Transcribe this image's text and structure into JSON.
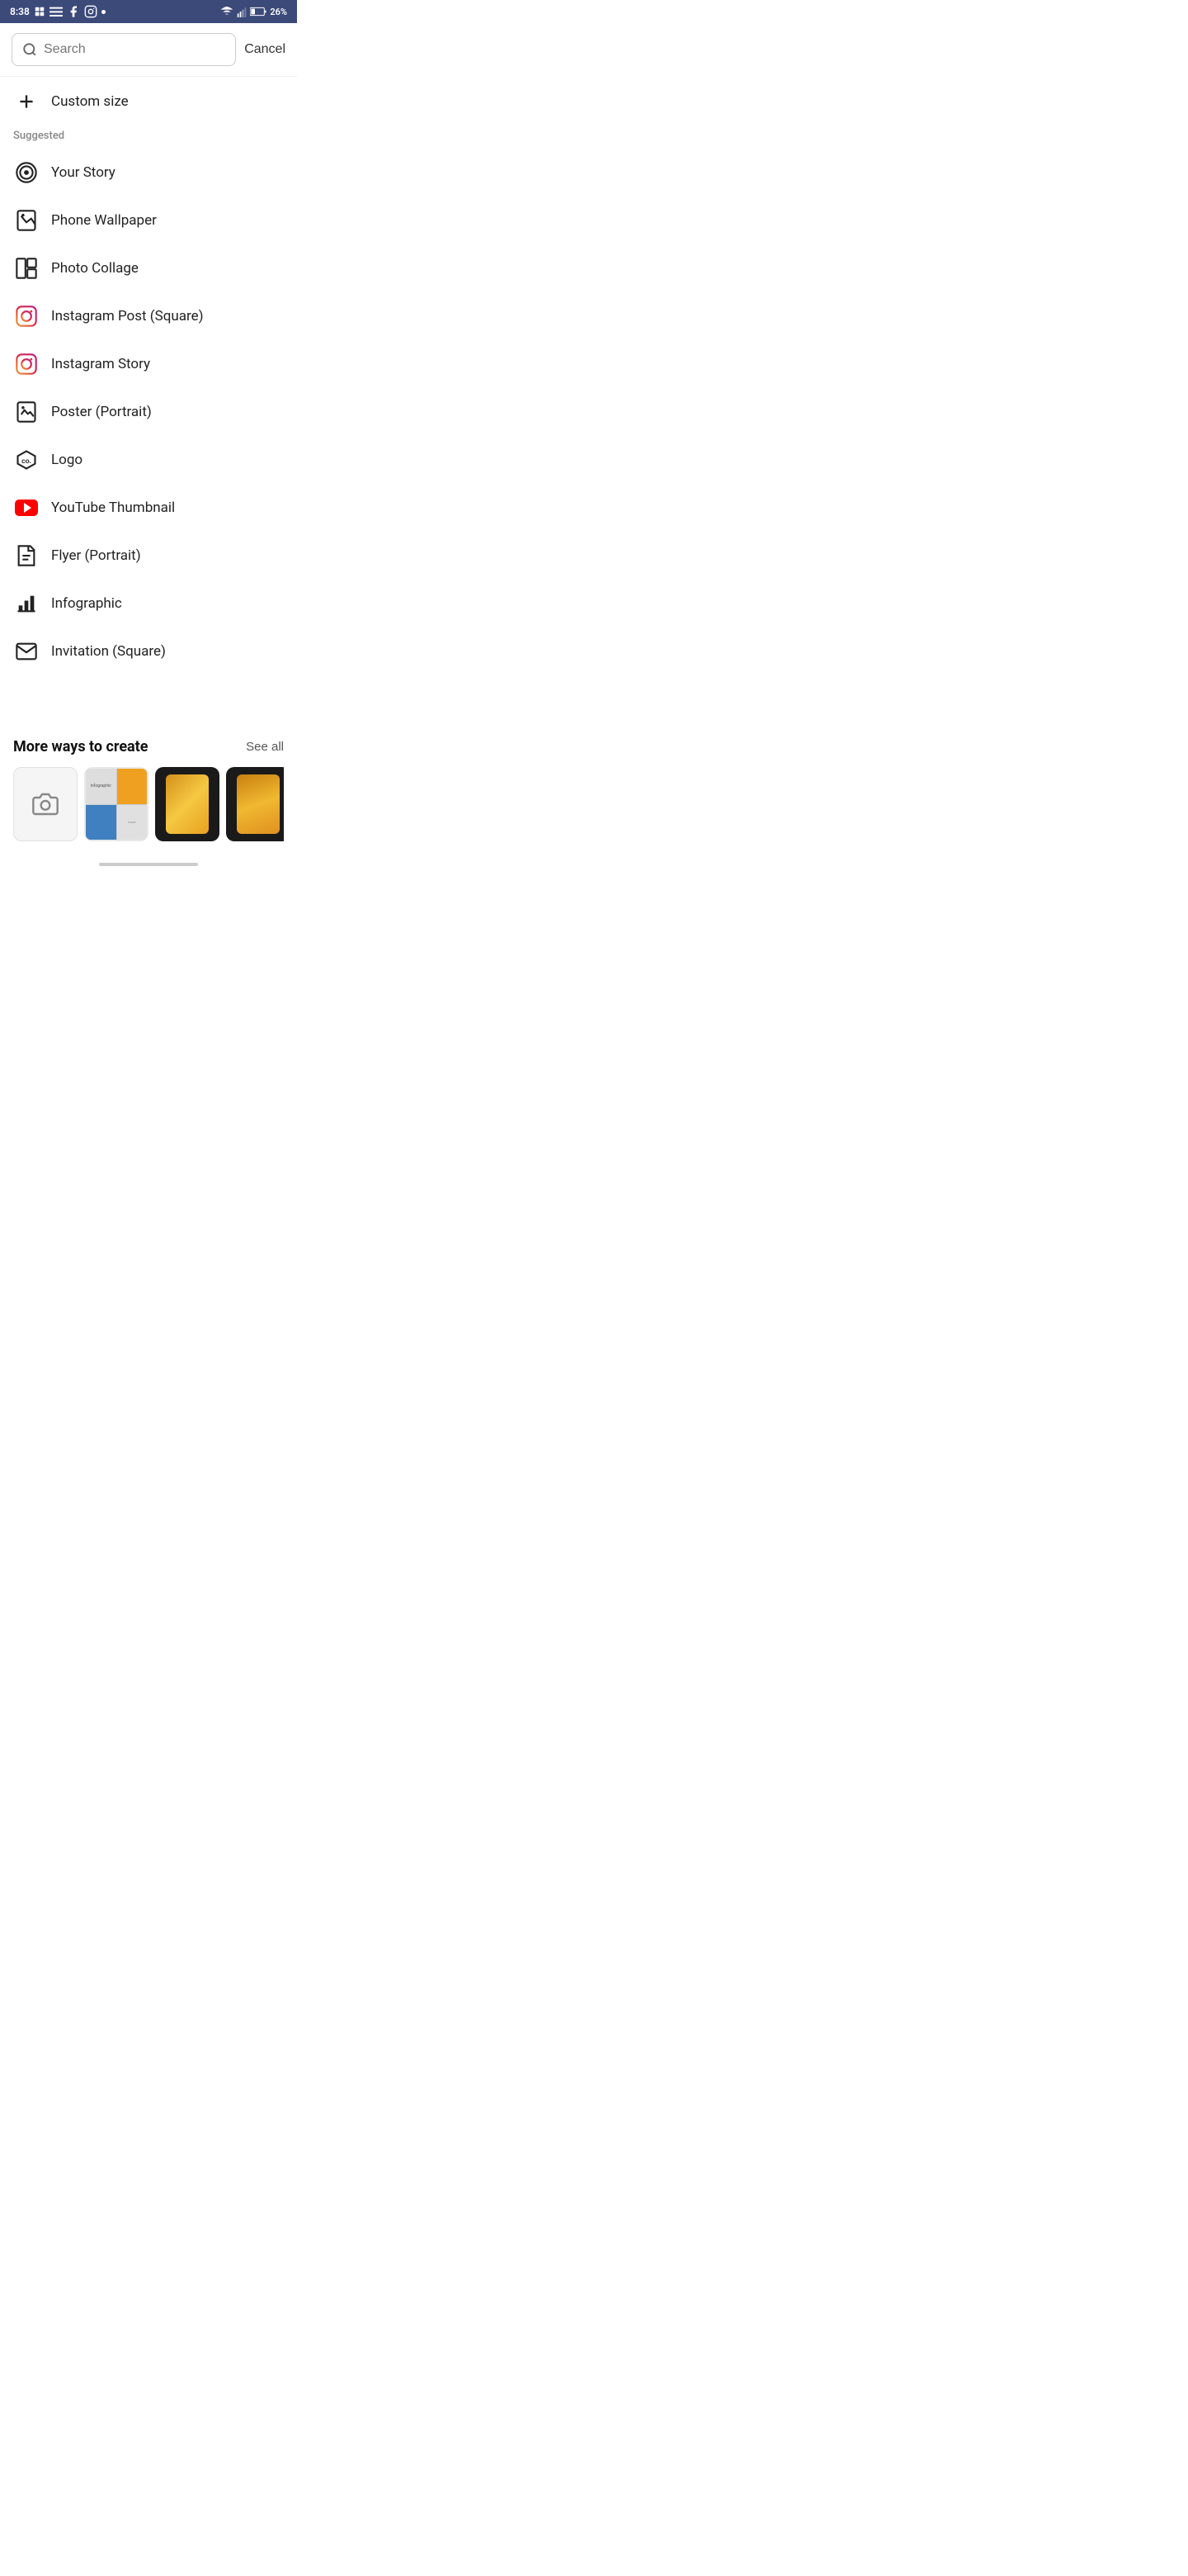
{
  "statusBar": {
    "time": "8:38",
    "battery": "26%"
  },
  "search": {
    "placeholder": "Search",
    "cancelLabel": "Cancel"
  },
  "customSize": {
    "label": "Custom size"
  },
  "suggested": {
    "sectionLabel": "Suggested",
    "items": [
      {
        "id": "your-story",
        "label": "Your Story",
        "icon": "camera-story"
      },
      {
        "id": "phone-wallpaper",
        "label": "Phone Wallpaper",
        "icon": "phone-wallpaper"
      },
      {
        "id": "photo-collage",
        "label": "Photo Collage",
        "icon": "photo-collage"
      },
      {
        "id": "instagram-post-square",
        "label": "Instagram Post (Square)",
        "icon": "instagram"
      },
      {
        "id": "instagram-story",
        "label": "Instagram Story",
        "icon": "instagram"
      },
      {
        "id": "poster-portrait",
        "label": "Poster (Portrait)",
        "icon": "poster"
      },
      {
        "id": "logo",
        "label": "Logo",
        "icon": "logo"
      },
      {
        "id": "youtube-thumbnail",
        "label": "YouTube Thumbnail",
        "icon": "youtube"
      },
      {
        "id": "flyer-portrait",
        "label": "Flyer (Portrait)",
        "icon": "flyer"
      },
      {
        "id": "infographic",
        "label": "Infographic",
        "icon": "infographic"
      },
      {
        "id": "invitation-square",
        "label": "Invitation (Square)",
        "icon": "invitation"
      }
    ]
  },
  "moreWays": {
    "title": "More ways to create",
    "seeAllLabel": "See all"
  }
}
